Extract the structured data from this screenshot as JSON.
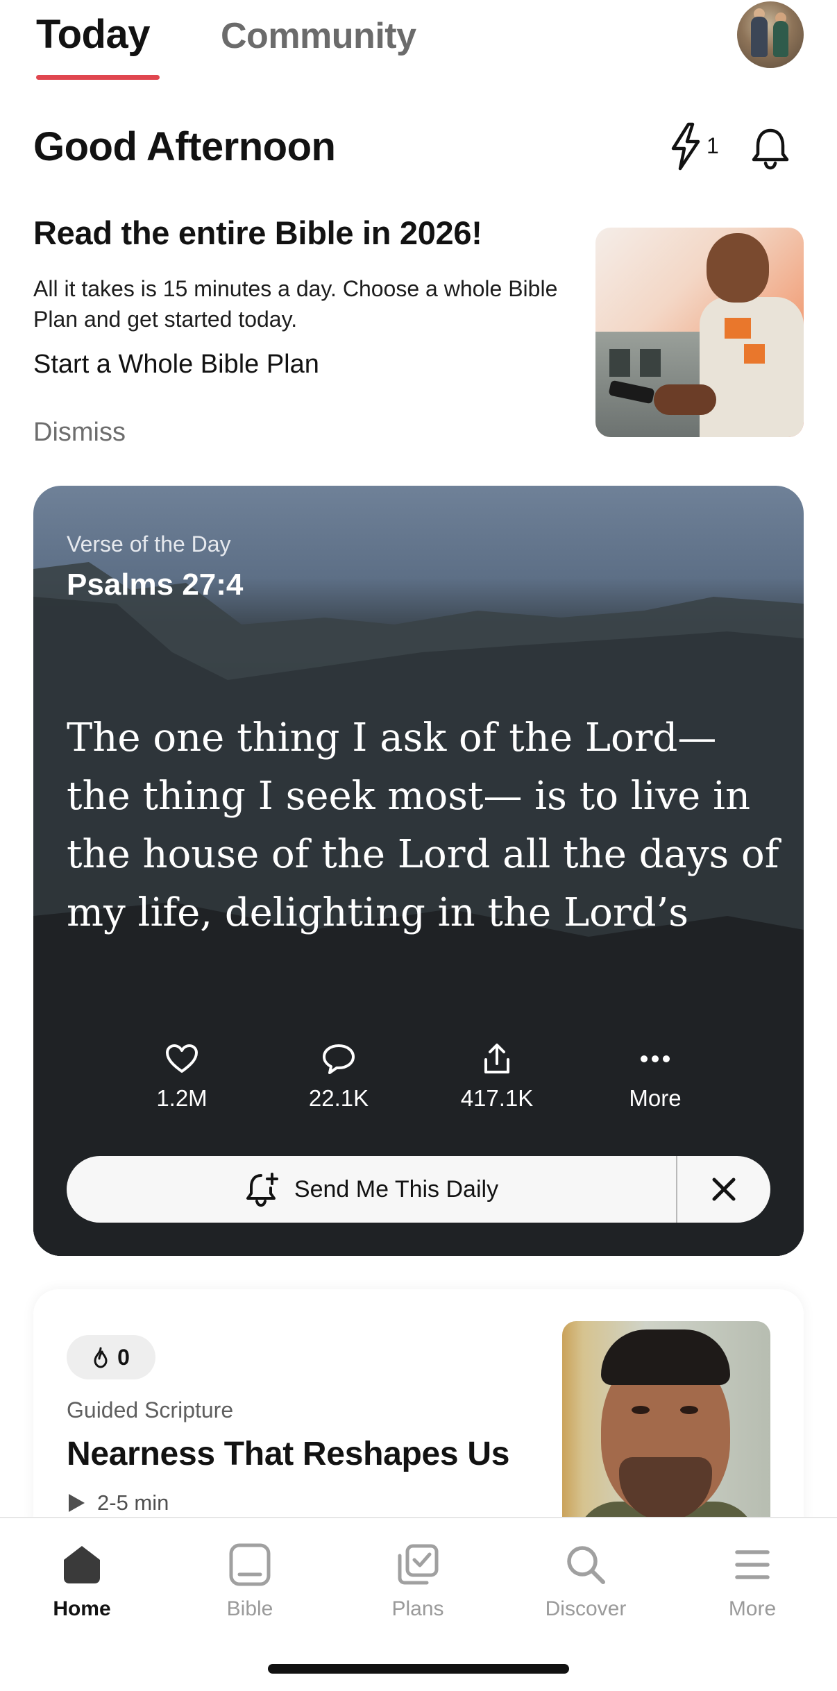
{
  "tabs": [
    {
      "label": "Today",
      "active": true
    },
    {
      "label": "Community",
      "active": false
    }
  ],
  "header": {
    "greeting": "Good Afternoon",
    "streak_count": "1"
  },
  "promo": {
    "title": "Read the entire Bible in 2026!",
    "body": "All it takes is 15 minutes a day. Choose a whole Bible Plan and get started today.",
    "cta": "Start a Whole Bible Plan",
    "dismiss": "Dismiss"
  },
  "verse": {
    "label": "Verse of the Day",
    "reference": "Psalms 27:4",
    "text": "The one thing I ask of the Lord— the thing I seek most— is to live in the house of the Lord all the days of my life, delighting in the Lord’s perfecti…",
    "actions": [
      {
        "icon": "heart-icon",
        "label": "1.2M"
      },
      {
        "icon": "comment-icon",
        "label": "22.1K"
      },
      {
        "icon": "share-icon",
        "label": "417.1K"
      },
      {
        "icon": "ellipsis-icon",
        "label": "More"
      }
    ],
    "send_daily": "Send Me This Daily"
  },
  "guided": {
    "streak": "0",
    "kicker": "Guided Scripture",
    "title": "Nearness That Reshapes Us",
    "duration": "2-5 min"
  },
  "nav": [
    {
      "label": "Home",
      "active": true
    },
    {
      "label": "Bible",
      "active": false
    },
    {
      "label": "Plans",
      "active": false
    },
    {
      "label": "Discover",
      "active": false
    },
    {
      "label": "More",
      "active": false
    }
  ],
  "colors": {
    "accent": "#e0464f",
    "text": "#121212",
    "muted": "#9a9a9a"
  }
}
